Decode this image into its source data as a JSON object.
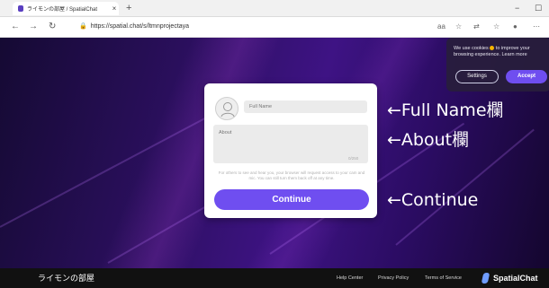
{
  "browser": {
    "tab_title": "ライモンの部屋 / SpatialChat",
    "tab_close": "×",
    "new_tab": "+",
    "url": "https://spatial.chat/s/ltmnprojectaya",
    "minimize": "−",
    "restore": "☐",
    "back": "←",
    "forward": "→",
    "reload": "↻",
    "lock": "🔒",
    "toolbar_icons": [
      "aa",
      "☆",
      "⇄",
      "☆",
      "●",
      "⋯"
    ]
  },
  "cookie_banner": {
    "text_before": "We use cookies",
    "text_after": "to improve your browsing experience. Learn more",
    "settings_label": "Settings",
    "accept_label": "Accept",
    "dot_color": "#f5b400"
  },
  "form": {
    "name_placeholder": "Full Name",
    "about_placeholder": "About",
    "char_counter": "0/250",
    "notice": "For others to see and hear you, your browser will request access to your cam and mic. You can still turn them back off at any time.",
    "continue_label": "Continue",
    "accent_color": "#6f4ef0"
  },
  "annotations": {
    "full_name": "←Full Name欄",
    "about": "←About欄",
    "continue": "←Continue"
  },
  "footer": {
    "room_name": "ライモンの部屋",
    "links": [
      "Help Center",
      "Privacy Policy",
      "Terms of Service"
    ],
    "brand": "SpatialChat"
  }
}
